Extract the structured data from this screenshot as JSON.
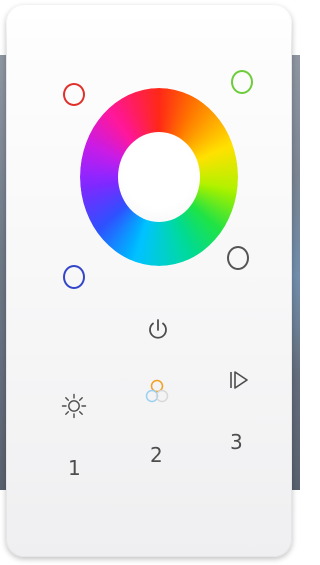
{
  "panel": {
    "rings": {
      "red": "#e0302a",
      "green": "#6ccc3a",
      "blue": "#3345c8",
      "white": "#555555"
    },
    "icons": [
      "power-icon",
      "sun-icon",
      "rgb-color-mix-icon",
      "play-icon"
    ],
    "buttons": {
      "one": "1",
      "two": "2",
      "three": "3"
    },
    "colors": {
      "panel": "#f8f8f9",
      "icon": "#4d4d4d"
    }
  }
}
